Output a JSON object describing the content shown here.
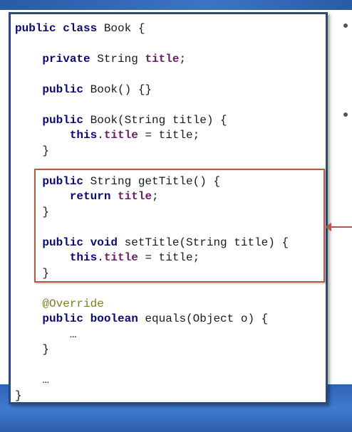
{
  "code": {
    "lines": [
      {
        "id": "l1",
        "segments": [
          {
            "t": "public class",
            "c": "kw"
          },
          {
            "t": " Book {",
            "c": ""
          }
        ]
      },
      {
        "id": "l2",
        "segments": [
          {
            "t": "    ",
            "c": ""
          },
          {
            "t": "private",
            "c": "kw"
          },
          {
            "t": " String ",
            "c": ""
          },
          {
            "t": "title",
            "c": "fld"
          },
          {
            "t": ";",
            "c": ""
          }
        ]
      },
      {
        "id": "l3",
        "segments": [
          {
            "t": "    ",
            "c": ""
          },
          {
            "t": "public",
            "c": "kw"
          },
          {
            "t": " Book() {}",
            "c": ""
          }
        ]
      },
      {
        "id": "l4",
        "segments": [
          {
            "t": "    ",
            "c": ""
          },
          {
            "t": "public",
            "c": "kw"
          },
          {
            "t": " Book(String title) {",
            "c": ""
          }
        ]
      },
      {
        "id": "l5",
        "segments": [
          {
            "t": "        ",
            "c": ""
          },
          {
            "t": "this",
            "c": "kw"
          },
          {
            "t": ".",
            "c": ""
          },
          {
            "t": "title",
            "c": "fld"
          },
          {
            "t": " = title;",
            "c": ""
          }
        ]
      },
      {
        "id": "l6",
        "segments": [
          {
            "t": "    }",
            "c": ""
          }
        ]
      },
      {
        "id": "l7",
        "segments": [
          {
            "t": "    ",
            "c": ""
          },
          {
            "t": "public",
            "c": "kw"
          },
          {
            "t": " String getTitle() {",
            "c": ""
          }
        ]
      },
      {
        "id": "l8",
        "segments": [
          {
            "t": "        ",
            "c": ""
          },
          {
            "t": "return",
            "c": "kw"
          },
          {
            "t": " ",
            "c": ""
          },
          {
            "t": "title",
            "c": "fld"
          },
          {
            "t": ";",
            "c": ""
          }
        ]
      },
      {
        "id": "l9",
        "segments": [
          {
            "t": "    }",
            "c": ""
          }
        ]
      },
      {
        "id": "l10",
        "segments": [
          {
            "t": "    ",
            "c": ""
          },
          {
            "t": "public void",
            "c": "kw"
          },
          {
            "t": " setTitle(String title) {",
            "c": ""
          }
        ]
      },
      {
        "id": "l11",
        "segments": [
          {
            "t": "        ",
            "c": ""
          },
          {
            "t": "this",
            "c": "kw"
          },
          {
            "t": ".",
            "c": ""
          },
          {
            "t": "title",
            "c": "fld"
          },
          {
            "t": " = title;",
            "c": ""
          }
        ]
      },
      {
        "id": "l12",
        "segments": [
          {
            "t": "    }",
            "c": ""
          }
        ]
      },
      {
        "id": "l13",
        "segments": [
          {
            "t": "    ",
            "c": ""
          },
          {
            "t": "@Override",
            "c": "ann"
          }
        ]
      },
      {
        "id": "l14",
        "segments": [
          {
            "t": "    ",
            "c": ""
          },
          {
            "t": "public boolean",
            "c": "kw"
          },
          {
            "t": " equals(Object o) {",
            "c": ""
          }
        ]
      },
      {
        "id": "l15",
        "segments": [
          {
            "t": "        …",
            "c": ""
          }
        ]
      },
      {
        "id": "l16",
        "segments": [
          {
            "t": "    }",
            "c": ""
          }
        ]
      },
      {
        "id": "l17",
        "segments": [
          {
            "t": "    …",
            "c": ""
          }
        ]
      },
      {
        "id": "l18",
        "segments": [
          {
            "t": "}",
            "c": ""
          }
        ]
      }
    ]
  },
  "colors": {
    "keyword": "#0a0a6e",
    "field": "#6b1f66",
    "annotation": "#7b7b2a",
    "highlight": "#b25a4a",
    "panel_border": "#2b4a78",
    "theme_blue": "#3d74c4"
  },
  "icons": [
    "bullet-icon",
    "arrow-icon"
  ]
}
